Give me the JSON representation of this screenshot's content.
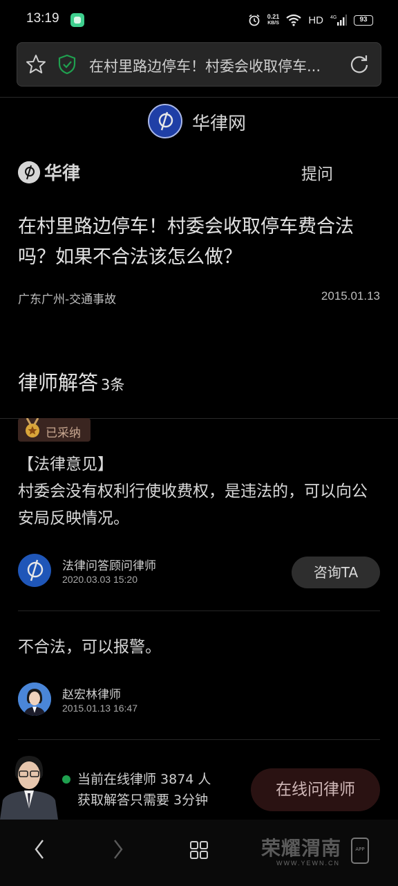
{
  "status_bar": {
    "time": "13:19",
    "net_speed_value": "0.21",
    "net_speed_unit": "KB/S",
    "hd": "HD",
    "network": "4G",
    "battery": "93"
  },
  "address_bar": {
    "title": "在村里路边停车！村委会收取停车费合法吗？如果不合法该怎么做？"
  },
  "site": {
    "name": "华律网",
    "brand": "华律",
    "ask_label": "提问"
  },
  "question": {
    "title": "在村里路边停车！村委会收取停车费合法吗？如果不合法该怎么做？",
    "category": "广东广州-交通事故",
    "date": "2015.01.13"
  },
  "answers": {
    "heading": "律师解答",
    "count": "3条",
    "adopted_label": "已采纳",
    "items": [
      {
        "heading": "【法律意见】",
        "text": "村委会没有权利行使收费权，是违法的，可以向公安局反映情况。",
        "lawyer": "法律问答顾问律师",
        "time": "2020.03.03 15:20",
        "consult_label": "咨询TA"
      },
      {
        "text": "不合法，可以报警。",
        "lawyer": "赵宏林律师",
        "time": "2015.01.13 16:47"
      }
    ]
  },
  "promo": {
    "online_text": "当前在线律师 3874 人",
    "wait_text": "获取解答只需要 3分钟",
    "button_label": "在线问律师"
  },
  "watermark": {
    "text": "荣耀渭南",
    "url": "WWW.YEWN.CN",
    "app_label": "APP"
  },
  "colors": {
    "background": "#000000",
    "online_dot": "#1fa04f",
    "brand_blue": "#1f3fa6",
    "app_green": "#3ecf8e"
  }
}
